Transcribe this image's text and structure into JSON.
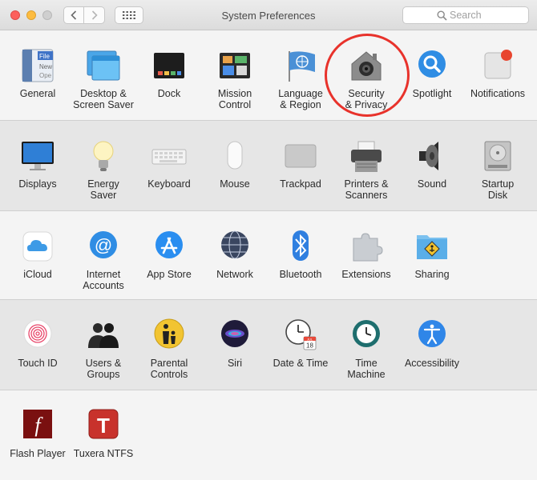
{
  "window": {
    "title": "System Preferences"
  },
  "search": {
    "placeholder": "Search"
  },
  "sections": [
    {
      "name": "personal",
      "items": [
        {
          "id": "general",
          "label": "General",
          "icon": "general-icon"
        },
        {
          "id": "desktop",
          "label": "Desktop &\nScreen Saver",
          "icon": "desktop-screensaver-icon"
        },
        {
          "id": "dock",
          "label": "Dock",
          "icon": "dock-icon"
        },
        {
          "id": "mission",
          "label": "Mission\nControl",
          "icon": "mission-control-icon"
        },
        {
          "id": "language",
          "label": "Language\n& Region",
          "icon": "language-region-icon"
        },
        {
          "id": "security",
          "label": "Security\n& Privacy",
          "icon": "security-privacy-icon"
        },
        {
          "id": "spotlight",
          "label": "Spotlight",
          "icon": "spotlight-icon"
        },
        {
          "id": "notifications",
          "label": "Notifications",
          "icon": "notifications-icon"
        }
      ]
    },
    {
      "name": "hardware",
      "items": [
        {
          "id": "displays",
          "label": "Displays",
          "icon": "displays-icon"
        },
        {
          "id": "energy",
          "label": "Energy\nSaver",
          "icon": "energy-saver-icon"
        },
        {
          "id": "keyboard",
          "label": "Keyboard",
          "icon": "keyboard-icon"
        },
        {
          "id": "mouse",
          "label": "Mouse",
          "icon": "mouse-icon"
        },
        {
          "id": "trackpad",
          "label": "Trackpad",
          "icon": "trackpad-icon"
        },
        {
          "id": "printers",
          "label": "Printers &\nScanners",
          "icon": "printer-icon"
        },
        {
          "id": "sound",
          "label": "Sound",
          "icon": "sound-icon"
        },
        {
          "id": "startup",
          "label": "Startup\nDisk",
          "icon": "startup-disk-icon"
        }
      ]
    },
    {
      "name": "internet",
      "items": [
        {
          "id": "icloud",
          "label": "iCloud",
          "icon": "icloud-icon"
        },
        {
          "id": "internet",
          "label": "Internet\nAccounts",
          "icon": "internet-accounts-icon"
        },
        {
          "id": "appstore",
          "label": "App Store",
          "icon": "app-store-icon"
        },
        {
          "id": "network",
          "label": "Network",
          "icon": "network-icon"
        },
        {
          "id": "bluetooth",
          "label": "Bluetooth",
          "icon": "bluetooth-icon"
        },
        {
          "id": "extensions",
          "label": "Extensions",
          "icon": "extensions-icon"
        },
        {
          "id": "sharing",
          "label": "Sharing",
          "icon": "sharing-icon"
        }
      ]
    },
    {
      "name": "system",
      "items": [
        {
          "id": "touchid",
          "label": "Touch ID",
          "icon": "touch-id-icon"
        },
        {
          "id": "users",
          "label": "Users &\nGroups",
          "icon": "users-groups-icon"
        },
        {
          "id": "parental",
          "label": "Parental\nControls",
          "icon": "parental-controls-icon"
        },
        {
          "id": "siri",
          "label": "Siri",
          "icon": "siri-icon"
        },
        {
          "id": "datetime",
          "label": "Date & Time",
          "icon": "date-time-icon"
        },
        {
          "id": "timemachine",
          "label": "Time\nMachine",
          "icon": "time-machine-icon"
        },
        {
          "id": "accessibility",
          "label": "Accessibility",
          "icon": "accessibility-icon"
        }
      ]
    },
    {
      "name": "other",
      "items": [
        {
          "id": "flash",
          "label": "Flash Player",
          "icon": "flash-player-icon"
        },
        {
          "id": "tuxera",
          "label": "Tuxera NTFS",
          "icon": "tuxera-ntfs-icon"
        }
      ]
    }
  ],
  "general_icon_text": {
    "line1": "File",
    "line2": "New",
    "line3": "Ope"
  },
  "calendar_icon_text": {
    "month": "JUL",
    "day": "18"
  },
  "highlighted_pane": "security",
  "highlight_color": "#e8322b"
}
